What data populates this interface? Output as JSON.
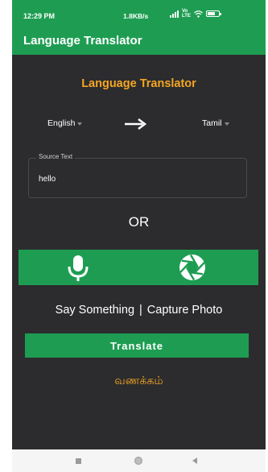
{
  "status_bar": {
    "time": "12:29 PM",
    "network_speed": "1.8KB/s",
    "volte": "Vo\nLTE",
    "battery_icon": "battery-icon",
    "battery_level": 0.6
  },
  "app_bar": {
    "title": "Language Translator"
  },
  "main": {
    "heading": "Language Translator",
    "source_language": "English",
    "target_language": "Tamil",
    "arrow_icon": "right-arrow-icon",
    "source_field": {
      "label": "Source Text",
      "value": "hello"
    },
    "or_label": "OR",
    "mic_icon": "microphone-icon",
    "camera_icon": "camera-shutter-icon",
    "say_something": "Say Something",
    "separator": "|",
    "capture_photo": "Capture Photo",
    "translate_button": "Translate",
    "result": "வணக்கம்"
  },
  "nav_bar": {
    "recents_icon": "square-icon",
    "home_icon": "circle-icon",
    "back_icon": "back-triangle-icon"
  },
  "colors": {
    "primary": "#1e9d52",
    "accent": "#f5a623",
    "background": "#2c2c2e"
  }
}
